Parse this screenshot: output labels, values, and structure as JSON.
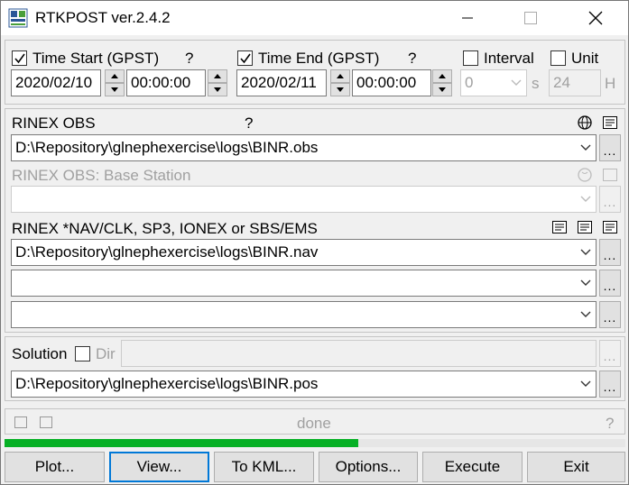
{
  "window": {
    "title": "RTKPOST ver.2.4.2"
  },
  "time": {
    "start_label": "Time Start (GPST)",
    "start_date": "2020/02/10",
    "start_time": "00:00:00",
    "end_label": "Time End (GPST)",
    "end_date": "2020/02/11",
    "end_time": "00:00:00",
    "help": "?",
    "interval_label": "Interval",
    "interval_value": "0",
    "interval_unit": "s",
    "unit_label": "Unit",
    "unit_value": "24",
    "unit_suffix": "H"
  },
  "inputs": {
    "rover_label": "RINEX OBS",
    "rover_help": "?",
    "rover_file": "D:\\Repository\\glnephexercise\\logs\\BINR.obs",
    "base_label": "RINEX OBS: Base Station",
    "base_file": "",
    "nav_label": "RINEX *NAV/CLK, SP3, IONEX or SBS/EMS",
    "nav_file1": "D:\\Repository\\glnephexercise\\logs\\BINR.nav",
    "nav_file2": "",
    "nav_file3": ""
  },
  "solution": {
    "label": "Solution",
    "dir_label": "Dir",
    "dir_value": "",
    "file": "D:\\Repository\\glnephexercise\\logs\\BINR.pos"
  },
  "status": {
    "message": "done",
    "help": "?",
    "progress": 0.57,
    "progress_color": "#06b025"
  },
  "buttons": {
    "plot": "Plot...",
    "view": "View...",
    "kml": "To KML...",
    "options": "Options...",
    "execute": "Execute",
    "exit": "Exit"
  }
}
